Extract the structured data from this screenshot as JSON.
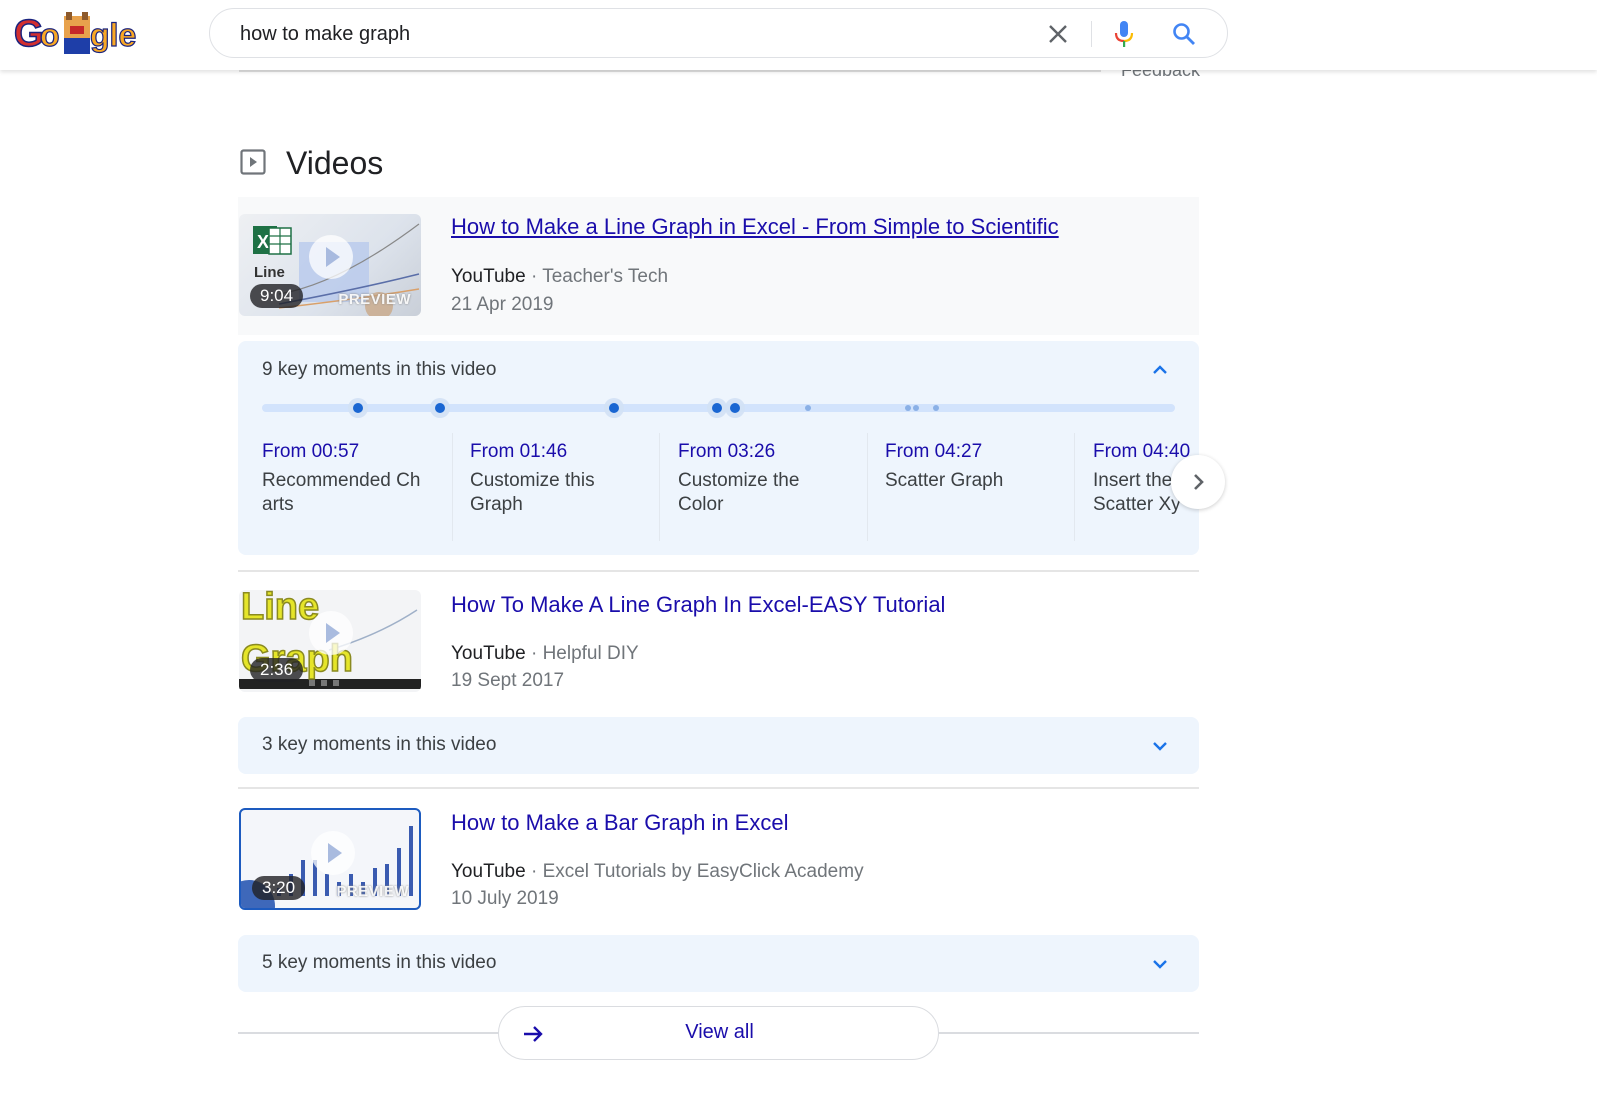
{
  "header": {
    "logo_alt": "Google Doodle",
    "search_query": "how to make graph",
    "icons": [
      "clear-icon",
      "mic-icon",
      "search-icon"
    ]
  },
  "feedback_label": "Feedback",
  "videos_section": {
    "title": "Videos",
    "icon": "video-play-icon",
    "videos": [
      {
        "title": "How to Make a Line Graph in Excel - From Simple to Scientific",
        "source": "YouTube",
        "channel": "Teacher's Tech",
        "date": "21 Apr 2019",
        "duration": "9:04",
        "preview_label": "PREVIEW",
        "thumb_text": "Line",
        "key_moments": {
          "label": "9 key moments in this video",
          "expanded": true,
          "timeline_progress": [
            0.105,
            0.195,
            0.386,
            0.498,
            0.518
          ],
          "timeline_minor": [
            0.598,
            0.708,
            0.716,
            0.738
          ],
          "items": [
            {
              "from": "From 00:57",
              "desc": "Recommended Charts"
            },
            {
              "from": "From 01:46",
              "desc": "Customize this Graph"
            },
            {
              "from": "From 03:26",
              "desc": "Customize the Color"
            },
            {
              "from": "From 04:27",
              "desc": "Scatter Graph"
            },
            {
              "from": "From 04:40",
              "desc": "Insert the Scatter Xy"
            }
          ]
        }
      },
      {
        "title": "How To Make A Line Graph In Excel-EASY Tutorial",
        "source": "YouTube",
        "channel": "Helpful DIY",
        "date": "19 Sept 2017",
        "duration": "2:36",
        "thumb_text_1": "Line",
        "thumb_text_2": "Graph",
        "key_moments": {
          "label": "3 key moments in this video",
          "expanded": false
        }
      },
      {
        "title": "How to Make a Bar Graph in Excel",
        "source": "YouTube",
        "channel": "Excel Tutorials by EasyClick Academy",
        "date": "10 July 2019",
        "duration": "3:20",
        "preview_label": "PREVIEW",
        "key_moments": {
          "label": "5 key moments in this video",
          "expanded": false
        }
      }
    ],
    "view_all_label": "View all"
  },
  "colors": {
    "link": "#1a0dab",
    "key_moments_bg": "#eef5fd",
    "timeline_dot": "#1a66d2",
    "timeline_track": "#d2e3fc"
  }
}
